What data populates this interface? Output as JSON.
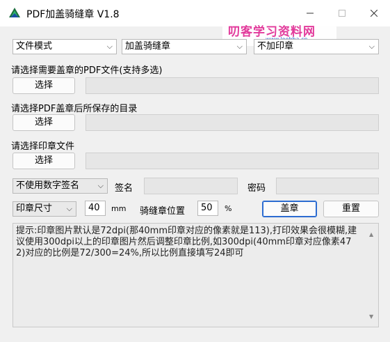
{
  "window": {
    "title": "PDF加盖骑缝章 V1.8",
    "minimize_icon": "minimize-icon",
    "maximize_icon": "maximize-icon",
    "close_icon": "close-icon"
  },
  "watermark": {
    "main": "叨客学习资料网",
    "sub": "www.leobba.cn"
  },
  "top_row": {
    "mode_select": "文件模式",
    "stamp_type_select": "加盖骑缝章",
    "seal_select": "不加印章"
  },
  "pdf_section": {
    "label": "请选择需要盖章的PDF文件(支持多选)",
    "button": "选择",
    "path": ""
  },
  "output_section": {
    "label": "请选择PDF盖章后所保存的目录",
    "button": "选择",
    "path": ""
  },
  "seal_section": {
    "label": "请选择印章文件",
    "button": "选择",
    "path": ""
  },
  "sign_row": {
    "digital_sign_select": "不使用数字签名",
    "sign_label": "签名",
    "sign_value": "",
    "password_label": "密码",
    "password_value": ""
  },
  "size_row": {
    "size_select": "印章尺寸",
    "size_value": "40",
    "size_unit": "mm",
    "position_label": "骑缝章位置",
    "position_value": "50",
    "position_unit": "%",
    "stamp_button": "盖章",
    "reset_button": "重置"
  },
  "hint_text": "提示:印章图片默认是72dpi(那40mm印章对应的像素就是113),打印效果会很模糊,建议使用300dpi以上的印章图片然后调整印章比例,如300dpi(40mm印章对应像素472)对应的比例是72/300=24%,所以比例直接填写24即可"
}
